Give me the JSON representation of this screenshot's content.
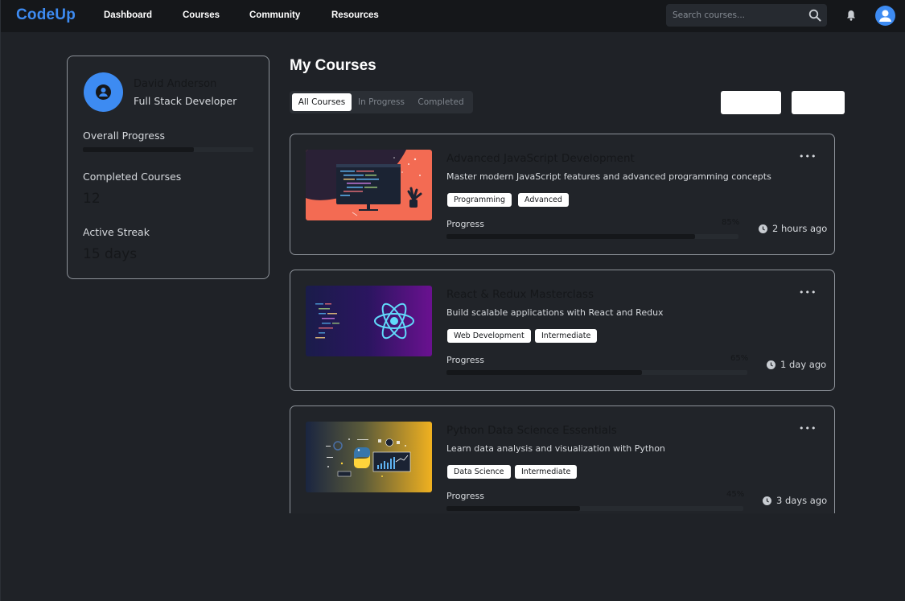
{
  "nav": {
    "brand": "CodeUp",
    "links": [
      "Dashboard",
      "Courses",
      "Community",
      "Resources"
    ],
    "search_placeholder": "Search courses...",
    "icons": [
      "search-icon",
      "bell-icon",
      "user-icon"
    ]
  },
  "profile": {
    "name": "David Anderson",
    "role": "Full Stack Developer",
    "overall_progress_label": "Overall Progress",
    "overall_progress": 0.65,
    "completed_label": "Completed Courses",
    "completed_value": "12",
    "streak_label": "Active Streak",
    "streak_value": "15 days"
  },
  "main": {
    "title": "My Courses",
    "tabs": [
      "All Courses",
      "In Progress",
      "Completed"
    ],
    "active_tab": "All Courses"
  },
  "courses": [
    {
      "title": "Advanced JavaScript Development",
      "description": "Master modern JavaScript features and advanced programming concepts",
      "tags": [
        "Programming",
        "Advanced"
      ],
      "progress_label": "Progress",
      "progress_text": "85%",
      "progress": 0.85,
      "time_ago": "2 hours ago"
    },
    {
      "title": "React & Redux Masterclass",
      "description": "Build scalable applications with React and Redux",
      "tags": [
        "Web Development",
        "Intermediate"
      ],
      "progress_label": "Progress",
      "progress_text": "65%",
      "progress": 0.65,
      "time_ago": "1 day ago"
    },
    {
      "title": "Python Data Science Essentials",
      "description": "Learn data analysis and visualization with Python",
      "tags": [
        "Data Science",
        "Intermediate"
      ],
      "progress_label": "Progress",
      "progress_text": "45%",
      "progress": 0.45,
      "time_ago": "3 days ago"
    }
  ],
  "colors": {
    "background": "#1f2227",
    "navbar": "#15171a",
    "accent": "#3d8bf2",
    "card_border": "#8d9299"
  }
}
